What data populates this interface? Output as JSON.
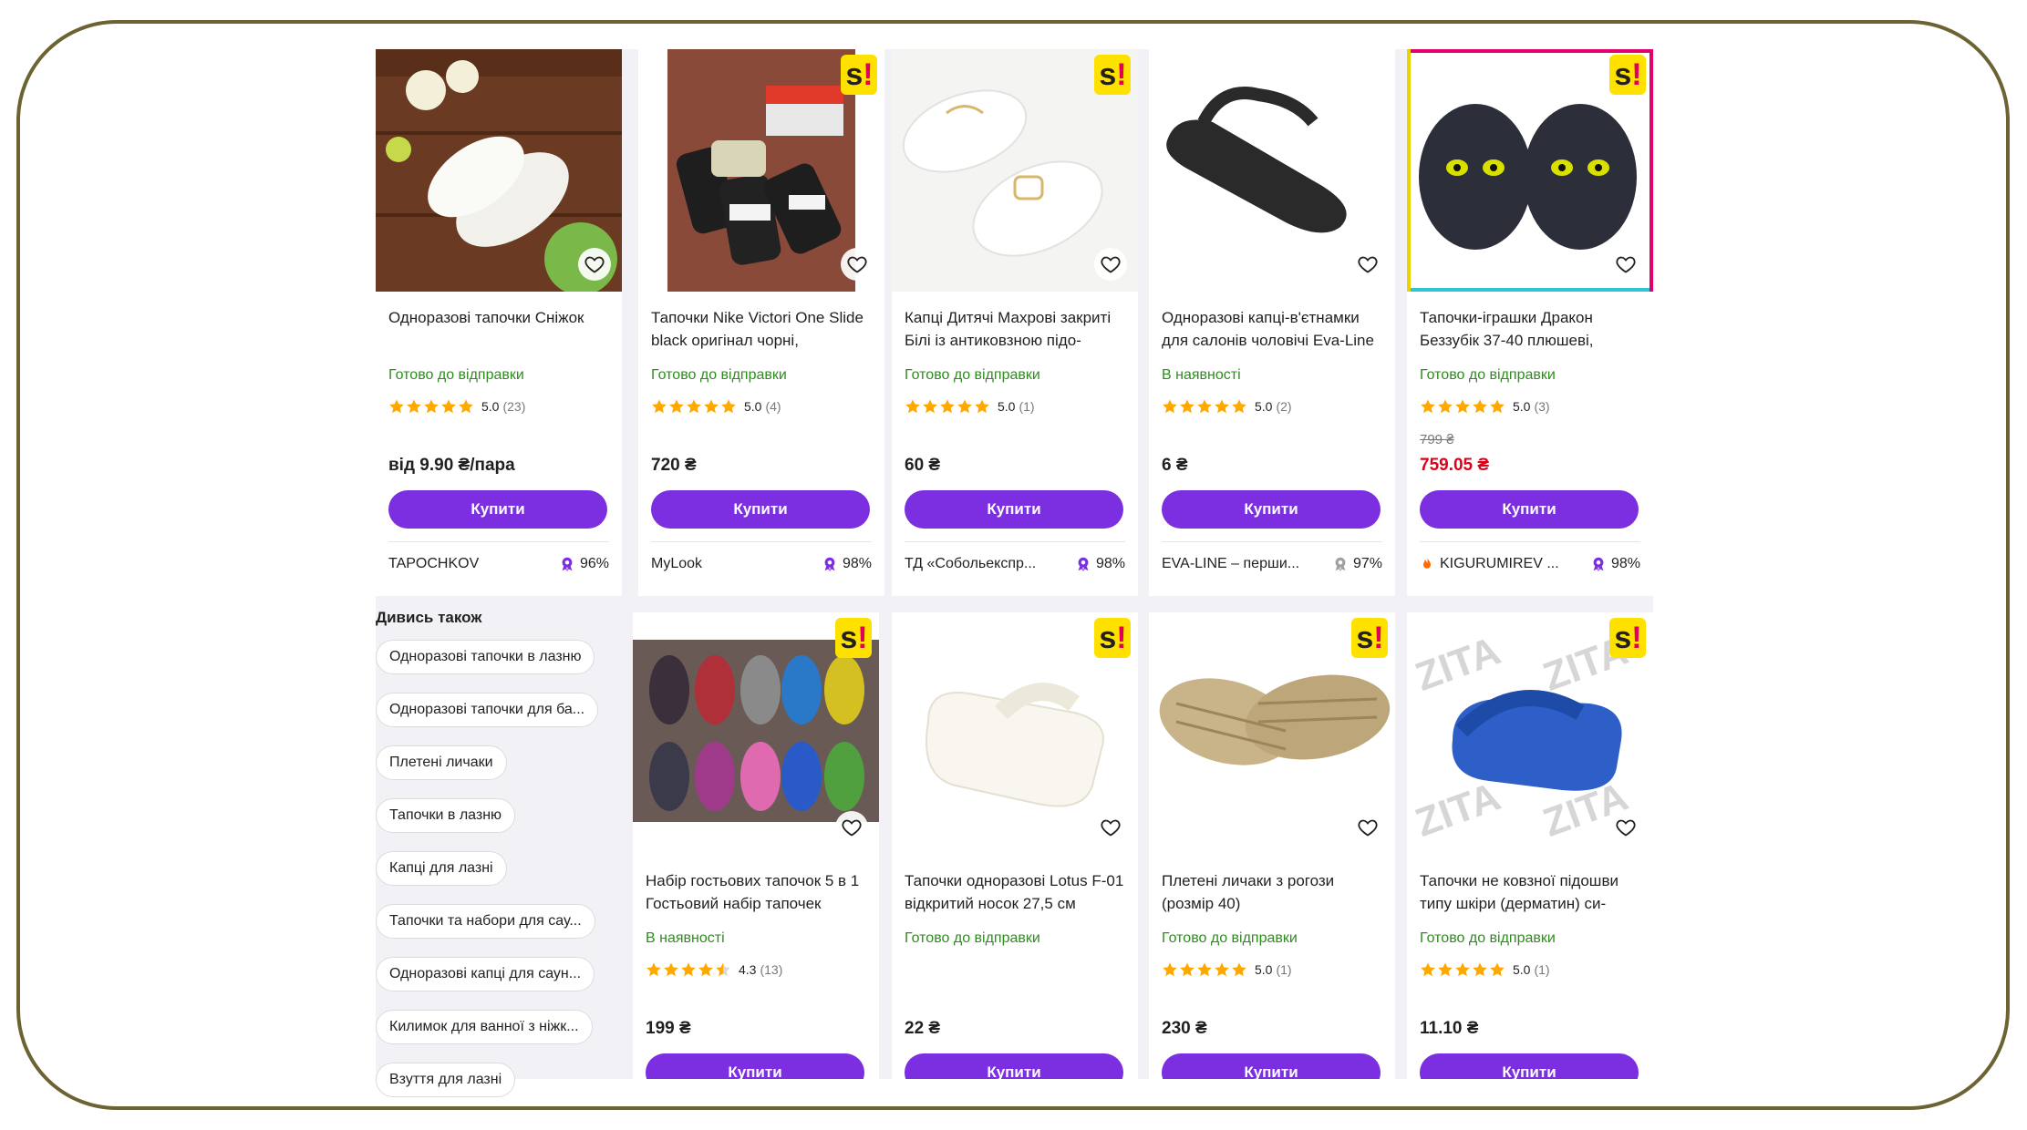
{
  "colors": {
    "buy": "#7b2fe0",
    "status": "#2f8c1f",
    "sale": "#e0001a",
    "star": "#ffa900",
    "frame": "#6b6331"
  },
  "buy_label": "Купити",
  "products_row1": [
    {
      "title": "Одноразові тапочки Сніжок",
      "status": "Готово до відправки",
      "score": "5.0",
      "count": "(23)",
      "old_price": "",
      "price": "від 9.90 ₴/пара",
      "seller": "TAPOCHKOV",
      "seller_rate": "96%",
      "badge": false
    },
    {
      "title": "Тапочки Nike Victori One Slide black оригінал чорні,",
      "status": "Готово до відправки",
      "score": "5.0",
      "count": "(4)",
      "old_price": "",
      "price": "720 ₴",
      "seller": "MyLook",
      "seller_rate": "98%",
      "badge": true
    },
    {
      "title": "Капці Дитячі Махрові закриті Білі із антиковзною підо-",
      "status": "Готово до відправки",
      "score": "5.0",
      "count": "(1)",
      "old_price": "",
      "price": "60 ₴",
      "seller": "ТД «Собольекспр...",
      "seller_rate": "98%",
      "badge": true
    },
    {
      "title": "Одноразові капці-в'єтнамки для салонів чоловічі Eva-Line",
      "status": "В наявності",
      "score": "5.0",
      "count": "(2)",
      "old_price": "",
      "price": "6 ₴",
      "seller": "EVA-LINE – перши...",
      "seller_rate": "97%",
      "badge": false
    },
    {
      "title": "Тапочки-іграшки Дракон Беззубік 37-40 плюшеві,",
      "status": "Готово до відправки",
      "score": "5.0",
      "count": "(3)",
      "old_price": "799 ₴",
      "price": "759.05 ₴",
      "seller": "KIGURUMIREV ...",
      "seller_rate": "98%",
      "badge": true
    }
  ],
  "products_row2": [
    {
      "title": "Набір гостьових тапочок 5 в 1 Гостьовий набір тапочек",
      "status": "В наявності",
      "score": "4.3",
      "count": "(13)",
      "price": "199 ₴",
      "badge": true
    },
    {
      "title": "Тапочки одноразові Lotus F-01 відкритий носок 27,5 см",
      "status": "Готово до відправки",
      "score": "",
      "count": "",
      "price": "22 ₴",
      "badge": true
    },
    {
      "title": "Плетені личаки з рогози (розмір 40)",
      "status": "Готово до відправки",
      "score": "5.0",
      "count": "(1)",
      "price": "230 ₴",
      "badge": true
    },
    {
      "title": "Тапочки не ковзної підошви типу шкіри (дерматин) си-",
      "status": "Готово до відправки",
      "score": "5.0",
      "count": "(1)",
      "price": "11.10 ₴",
      "badge": true
    }
  ],
  "see_also": {
    "title": "Дивись також",
    "chips": [
      "Одноразові тапочки в лазню",
      "Одноразові тапочки для ба...",
      "Плетені личаки",
      "Тапочки в лазню",
      "Капці для лазні",
      "Тапочки та набори для сау...",
      "Одноразові капці для саун...",
      "Килимок для ванної з ніжк...",
      "Взуття для лазні"
    ]
  }
}
